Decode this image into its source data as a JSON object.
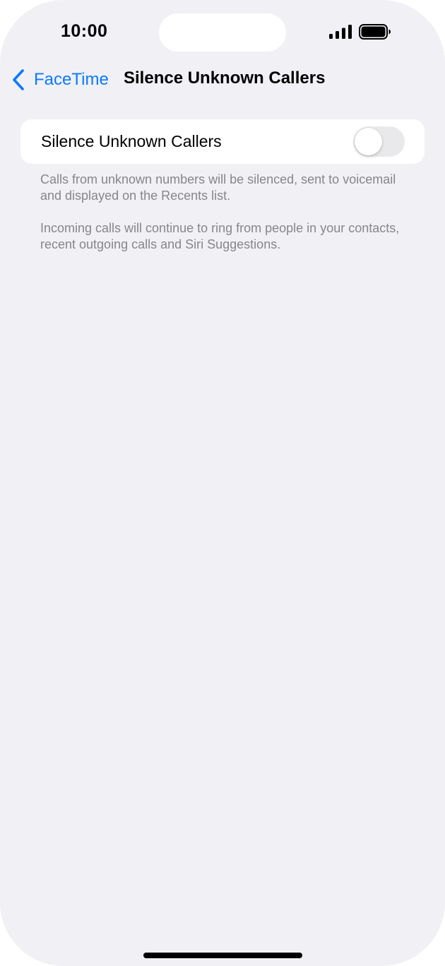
{
  "status_bar": {
    "time": "10:00",
    "icons": [
      "signal-icon",
      "battery-icon"
    ]
  },
  "nav": {
    "back_label": "FaceTime",
    "back_icon": "chevron-left-icon",
    "title": "Silence Unknown Callers"
  },
  "settings": {
    "row_label": "Silence Unknown Callers",
    "toggle_on": false
  },
  "footer": {
    "description_1": "Calls from unknown numbers will be silenced, sent to voicemail and displayed on the Recents list.",
    "description_2": "Incoming calls will continue to ring from people in your contacts, recent outgoing calls and Siri Suggestions."
  },
  "colors": {
    "accent": "#0a7aff",
    "background": "#f0f0f5",
    "card": "#ffffff",
    "secondary_text": "#86868b",
    "toggle_off": "#e9e9eb"
  }
}
